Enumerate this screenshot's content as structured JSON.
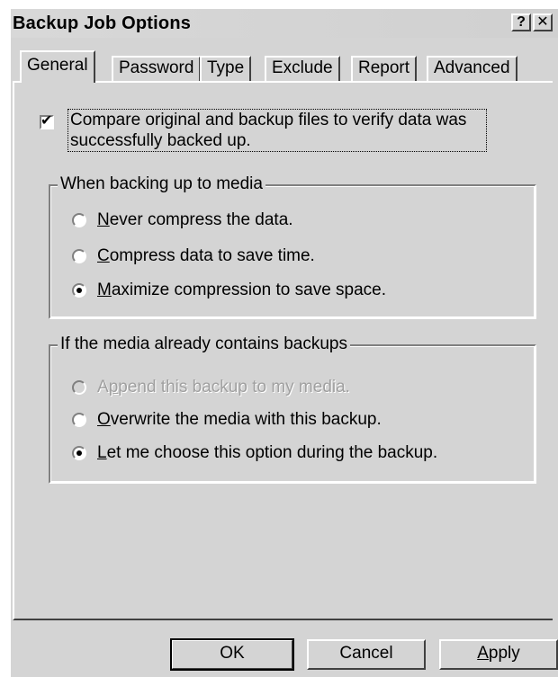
{
  "window": {
    "title": "Backup Job Options",
    "help_icon": "question-mark-icon",
    "close_icon": "close-icon"
  },
  "tabs": [
    {
      "label": "General",
      "active": true
    },
    {
      "label": "Password",
      "active": false
    },
    {
      "label": "Type",
      "active": false
    },
    {
      "label": "Exclude",
      "active": false
    },
    {
      "label": "Report",
      "active": false
    },
    {
      "label": "Advanced",
      "active": false
    }
  ],
  "verify_checkbox": {
    "checked": true,
    "label_line1": "Compare original and backup files to verify data was",
    "label_line2": "successfully backed up."
  },
  "compression_group": {
    "label": "When backing up to media",
    "options": [
      {
        "mnemonic": "N",
        "rest": "ever compress the data.",
        "selected": false,
        "enabled": true
      },
      {
        "mnemonic": "C",
        "rest": "ompress data to save time.",
        "selected": false,
        "enabled": true
      },
      {
        "mnemonic": "M",
        "rest": "aximize compression to save space.",
        "selected": true,
        "enabled": true
      }
    ]
  },
  "existing_group": {
    "label": "If the media already contains backups",
    "options": [
      {
        "pre": "A",
        "mnemonic": "p",
        "rest": "pend this backup to my media.",
        "selected": false,
        "enabled": false
      },
      {
        "pre": "",
        "mnemonic": "O",
        "rest": "verwrite the media with this backup.",
        "selected": false,
        "enabled": true
      },
      {
        "pre": "",
        "mnemonic": "L",
        "rest": "et me choose this option during the backup.",
        "selected": true,
        "enabled": true
      }
    ]
  },
  "buttons": {
    "ok": "OK",
    "cancel": "Cancel",
    "apply_mnemonic": "A",
    "apply_rest": "pply"
  },
  "colors": {
    "face": "#d4d4d4",
    "disabled_text": "#a0a0a0"
  }
}
